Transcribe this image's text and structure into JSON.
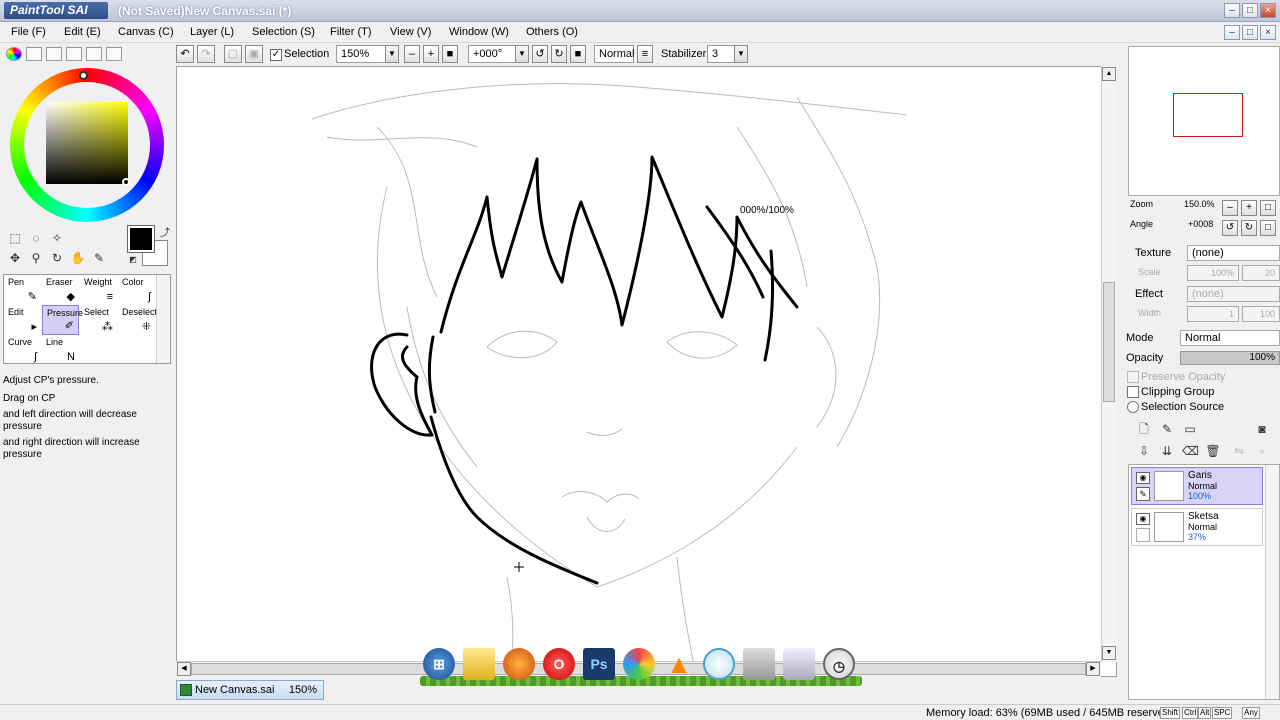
{
  "window": {
    "app_logo": "PaintTool SAI",
    "title": "(Not Saved)New Canvas.sai (*)"
  },
  "menu": [
    "File (F)",
    "Edit (E)",
    "Canvas (C)",
    "Layer (L)",
    "Selection (S)",
    "Filter (T)",
    "View (V)",
    "Window (W)",
    "Others (O)"
  ],
  "toolbar": {
    "selection_label": "Selection",
    "zoom": "150%",
    "angle": "+000°",
    "blend": "Normal",
    "stabilizer_label": "Stabilizer",
    "stabilizer_value": "3"
  },
  "tools": {
    "items": [
      {
        "label": "Pen",
        "icon": "pen-icon"
      },
      {
        "label": "Eraser",
        "icon": "eraser-icon"
      },
      {
        "label": "Weight",
        "icon": "weight-icon"
      },
      {
        "label": "Color",
        "icon": "color-icon"
      },
      {
        "label": "Edit",
        "icon": "edit-icon"
      },
      {
        "label": "Pressure",
        "icon": "pressure-icon"
      },
      {
        "label": "Select",
        "icon": "select-icon"
      },
      {
        "label": "Deselect",
        "icon": "deselect-icon"
      },
      {
        "label": "Curve",
        "icon": "curve-icon"
      },
      {
        "label": "Line",
        "icon": "line-icon"
      }
    ],
    "selected": "Pressure"
  },
  "help": {
    "title": "Adjust CP's pressure.",
    "line1": "Drag on CP",
    "line2": "and left direction will decrease pressure",
    "line3": "and right direction will increase pressure"
  },
  "canvas": {
    "overlay_text": "000%/100%"
  },
  "document_tab": {
    "name": "New Canvas.sai",
    "zoom": "150%"
  },
  "dock": {
    "icons": [
      "windows-start-icon",
      "folder-icon",
      "firefox-icon",
      "opera-icon",
      "photoshop-icon",
      "picasa-icon",
      "vlc-icon",
      "disc-icon",
      "scanner-icon",
      "recycle-bin-icon",
      "clock-icon"
    ],
    "photoshop_text": "Ps"
  },
  "navigator": {
    "zoom_label": "Zoom",
    "zoom_value": "150.0%",
    "angle_label": "Angle",
    "angle_value": "+0008"
  },
  "brush_panel": {
    "texture_label": "Texture",
    "texture_value": "(none)",
    "scale_label": "Scale",
    "scale_value": "100%",
    "scale_value2": "20",
    "effect_label": "Effect",
    "effect_value": "(none)",
    "width_label": "Width",
    "width_value": "1",
    "width_value2": "100"
  },
  "layer_props": {
    "mode_label": "Mode",
    "mode_value": "Normal",
    "opacity_label": "Opacity",
    "opacity_value": "100%",
    "opacity_fraction": 1.0,
    "preserve_opacity": "Preserve Opacity",
    "clipping_group": "Clipping Group",
    "selection_source": "Selection Source"
  },
  "layers": [
    {
      "name": "Garis",
      "mode": "Normal",
      "opacity": "100%",
      "selected": true
    },
    {
      "name": "Sketsa",
      "mode": "Normal",
      "opacity": "37%",
      "selected": false
    }
  ],
  "status": {
    "memory": "Memory load: 63% (69MB used / 645MB reserved)",
    "keys": [
      "Shift",
      "Ctrl",
      "Alt",
      "SPC",
      "Any"
    ]
  },
  "colors": {
    "accent_select": "#d4d0f5",
    "foreground": "#000000",
    "background": "#ffffff"
  }
}
